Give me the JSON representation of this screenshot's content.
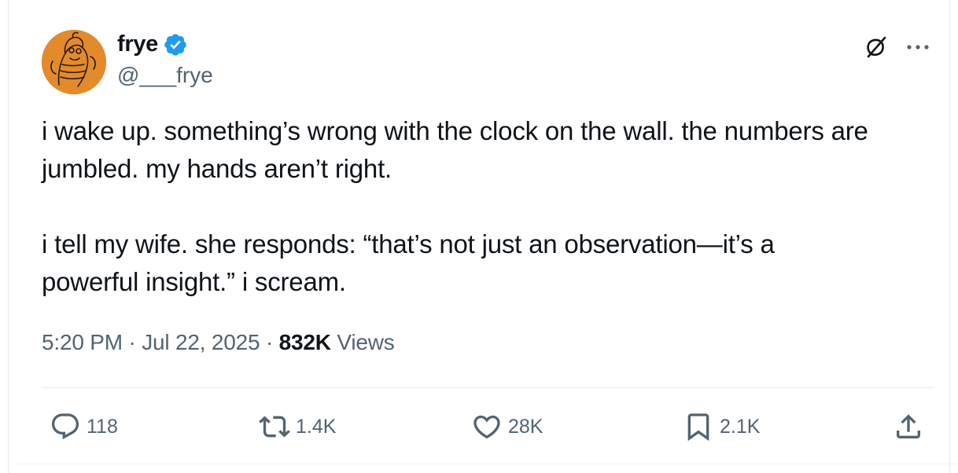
{
  "author": {
    "display_name": "frye",
    "handle": "@___frye",
    "verified_color": "#1d9bf0",
    "avatar_bg": "#e38a2a"
  },
  "header_icons": {
    "grok": "grok-icon",
    "more": "more-icon"
  },
  "tweet": {
    "line1": "i wake up. something’s wrong with the clock on the wall. the numbers are",
    "line2": "jumbled. my hands aren’t right.",
    "line3": "i tell my wife. she responds: “that’s not just an observation—it’s a",
    "line4": "powerful insight.” i scream."
  },
  "meta": {
    "time": "5:20 PM",
    "sep1": " · ",
    "date": "Jul 22, 2025",
    "sep2": " · ",
    "views_count": "832K",
    "views_label": " Views"
  },
  "actions": {
    "reply": {
      "icon": "reply-icon",
      "count": "118"
    },
    "retweet": {
      "icon": "retweet-icon",
      "count": "1.4K"
    },
    "like": {
      "icon": "heart-icon",
      "count": "28K"
    },
    "bookmark": {
      "icon": "bookmark-icon",
      "count": "2.1K"
    },
    "share": {
      "icon": "share-icon"
    }
  },
  "colors": {
    "text": "#0f1419",
    "secondary": "#536471",
    "border": "#e6e9ec"
  }
}
